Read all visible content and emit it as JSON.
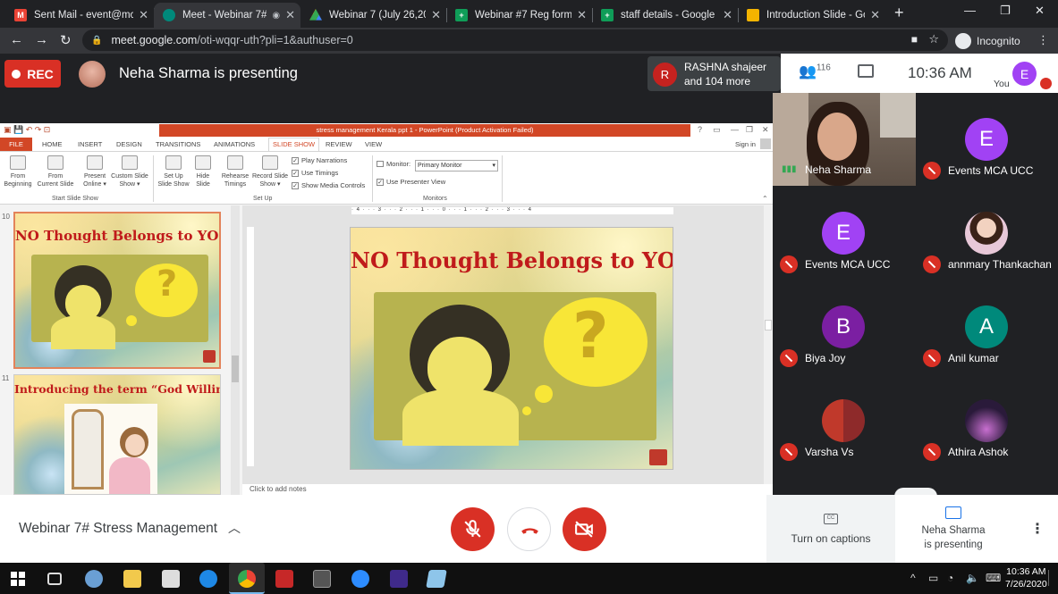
{
  "browser": {
    "tabs": [
      {
        "title": "Sent Mail - event@mca",
        "fav_color": "#ea4335",
        "fav": "M",
        "active": false
      },
      {
        "title": "Meet - Webinar 7#",
        "fav_color": "#00897b",
        "fav": "",
        "active": true
      },
      {
        "title": "Webinar 7 (July 26,2020",
        "fav_color": "#fbbc04",
        "fav": "",
        "active": false
      },
      {
        "title": "Webinar #7 Reg form (",
        "fav_color": "#0f9d58",
        "fav": "+",
        "active": false
      },
      {
        "title": "staff details - Google Sl",
        "fav_color": "#0f9d58",
        "fav": "+",
        "active": false
      },
      {
        "title": "Introduction Slide - Goo",
        "fav_color": "#f4b400",
        "fav": "",
        "active": false
      }
    ],
    "url_host": "meet.google.com",
    "url_path": "/oti-wqqr-uth?pli=1&authuser=0",
    "incognito_label": "Incognito"
  },
  "meet": {
    "rec_label": "REC",
    "presenting_text": "Neha Sharma is presenting",
    "notification": {
      "initial": "R",
      "line1": "RASHNA shajeer",
      "line2": "and 104 more"
    },
    "people_count": "116",
    "time": "10:36 AM",
    "self": {
      "initial": "E",
      "label": "You"
    },
    "meeting_title": "Webinar 7# Stress Management",
    "captions_label": "Turn on captions",
    "cc_icon": "CC",
    "presenting_line1": "Neha Sharma",
    "presenting_line2": "is presenting",
    "participants": [
      {
        "name": "Neha Sharma",
        "initial": "",
        "color": ""
      },
      {
        "name": "Events MCA UCC",
        "initial": "E",
        "color": "#a142f4"
      },
      {
        "name": "Events MCA UCC",
        "initial": "E",
        "color": "#a142f4"
      },
      {
        "name": "annmary Thankachan",
        "initial": "",
        "color": "#e6c4d5"
      },
      {
        "name": "Biya Joy",
        "initial": "B",
        "color": "#7b1fa2"
      },
      {
        "name": "Anil kumar",
        "initial": "A",
        "color": "#00897b"
      },
      {
        "name": "Varsha Vs",
        "initial": "",
        "color": "#b0453c"
      },
      {
        "name": "Athira Ashok",
        "initial": "",
        "color": "#3a2a4a"
      }
    ]
  },
  "ppt": {
    "window_title": "stress management Kerala ppt 1  -  PowerPoint (Product Activation Failed)",
    "tabs": [
      "FILE",
      "HOME",
      "INSERT",
      "DESIGN",
      "TRANSITIONS",
      "ANIMATIONS",
      "SLIDE SHOW",
      "REVIEW",
      "VIEW"
    ],
    "sign_in": "Sign in",
    "ribbon": {
      "from_beginning": [
        "From",
        "Beginning"
      ],
      "from_current": [
        "From",
        "Current Slide"
      ],
      "present_online": [
        "Present",
        "Online ▾"
      ],
      "custom_show": [
        "Custom Slide",
        "Show ▾"
      ],
      "set_up": [
        "Set Up",
        "Slide Show"
      ],
      "hide_slide": [
        "Hide",
        "Slide"
      ],
      "rehearse": [
        "Rehearse",
        "Timings"
      ],
      "record": [
        "Record Slide",
        "Show ▾"
      ],
      "play_narrations": "Play Narrations",
      "use_timings": "Use Timings",
      "show_media_controls": "Show Media Controls",
      "monitor_label": "Monitor:",
      "monitor_value": "Primary Monitor",
      "use_presenter_view": "Use Presenter View",
      "group_start": "Start Slide Show",
      "group_setup": "Set Up",
      "group_monitors": "Monitors"
    },
    "ruler_text": "· 4 · · · 3 · · · 2 · · · 1 · · · 0 · · · 1 · · · 2 · · · 3 · · · 4",
    "thumb1_num": "10",
    "thumb1_title": "NO Thought Belongs to YOU",
    "thumb2_num": "11",
    "thumb2_title": "Introducing the term “God Willing”",
    "main_slide_title": "NO Thought Belongs to YOU",
    "notes_placeholder": "Click to add notes"
  },
  "taskbar": {
    "time": "10:36 AM",
    "date": "7/26/2020"
  }
}
